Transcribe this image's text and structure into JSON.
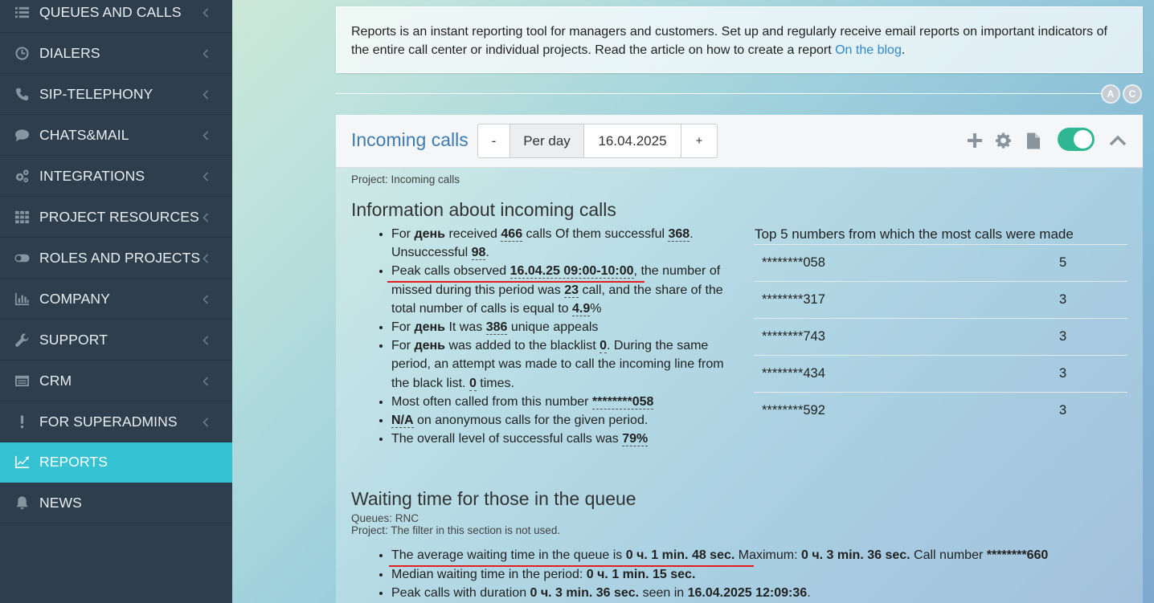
{
  "sidebar": {
    "items": [
      {
        "label": "QUEUES AND CALLS",
        "icon": "list-icon"
      },
      {
        "label": "DIALERS",
        "icon": "clock-icon"
      },
      {
        "label": "SIP-TELEPHONY",
        "icon": "phone-icon"
      },
      {
        "label": "CHATS&MAIL",
        "icon": "chat-icon"
      },
      {
        "label": "INTEGRATIONS",
        "icon": "gears-icon"
      },
      {
        "label": "PROJECT RESOURCES",
        "icon": "grid-icon"
      },
      {
        "label": "ROLES AND PROJECTS",
        "icon": "toggle-icon"
      },
      {
        "label": "COMPANY",
        "icon": "bar-chart-icon"
      },
      {
        "label": "SUPPORT",
        "icon": "wrench-icon"
      },
      {
        "label": "CRM",
        "icon": "window-icon"
      },
      {
        "label": "FOR SUPERADMINS",
        "icon": "exclamation-icon"
      },
      {
        "label": "REPORTS",
        "icon": "line-chart-icon",
        "active": true
      },
      {
        "label": "NEWS",
        "icon": "bell-icon"
      }
    ]
  },
  "info": {
    "text": "Reports is an instant reporting tool for managers and customers. Set up and regularly receive email reports on important indicators of the entire call center or individual projects. Read the article on how to create a report ",
    "link": "On the blog",
    "suffix": "."
  },
  "circles": {
    "a": "A",
    "c": "C"
  },
  "panel": {
    "title": "Incoming calls",
    "minus": "-",
    "period": "Per day",
    "date": "16.04.2025",
    "plus": "+",
    "toggle_on": true,
    "project": "Project: Incoming calls"
  },
  "incoming": {
    "title": "Information about incoming calls",
    "period_word": "день",
    "received": "466",
    "successful": "368",
    "unsuccessful": "98",
    "peak_time": "16.04.25 09:00-10:00",
    "missed": "23",
    "share": "4.9",
    "unique": "386",
    "blacklist_added": "0",
    "blacklist_attempts": "0",
    "most_often": "********058",
    "anonymous": "N/A",
    "success_level": "79%"
  },
  "top5": {
    "title": "Top 5 numbers from which the most calls were made",
    "rows": [
      {
        "number": "********058",
        "count": "5"
      },
      {
        "number": "********317",
        "count": "3"
      },
      {
        "number": "********743",
        "count": "3"
      },
      {
        "number": "********434",
        "count": "3"
      },
      {
        "number": "********592",
        "count": "3"
      }
    ]
  },
  "waiting": {
    "title": "Waiting time for those in the queue",
    "queues": "Queues: RNC",
    "project": "Project: The filter in this section is not used.",
    "avg_label": "The average waiting time in the queue is ",
    "avg_value": "0 ч. 1 min. 48 sec.",
    "max_label": " Maximum: ",
    "max_value": "0 ч. 3 min. 36 sec.",
    "call_label": " Call number ",
    "call_number": "********660",
    "median_label": "Median waiting time in the period: ",
    "median_value": "0 ч. 1 min. 15 sec.",
    "peak_label": "Peak calls with duration ",
    "peak_value": "0 ч. 3 min. 36 sec.",
    "seen_label": " seen in ",
    "seen_value": "16.04.2025 12:09:36",
    "seen_suffix": "."
  }
}
